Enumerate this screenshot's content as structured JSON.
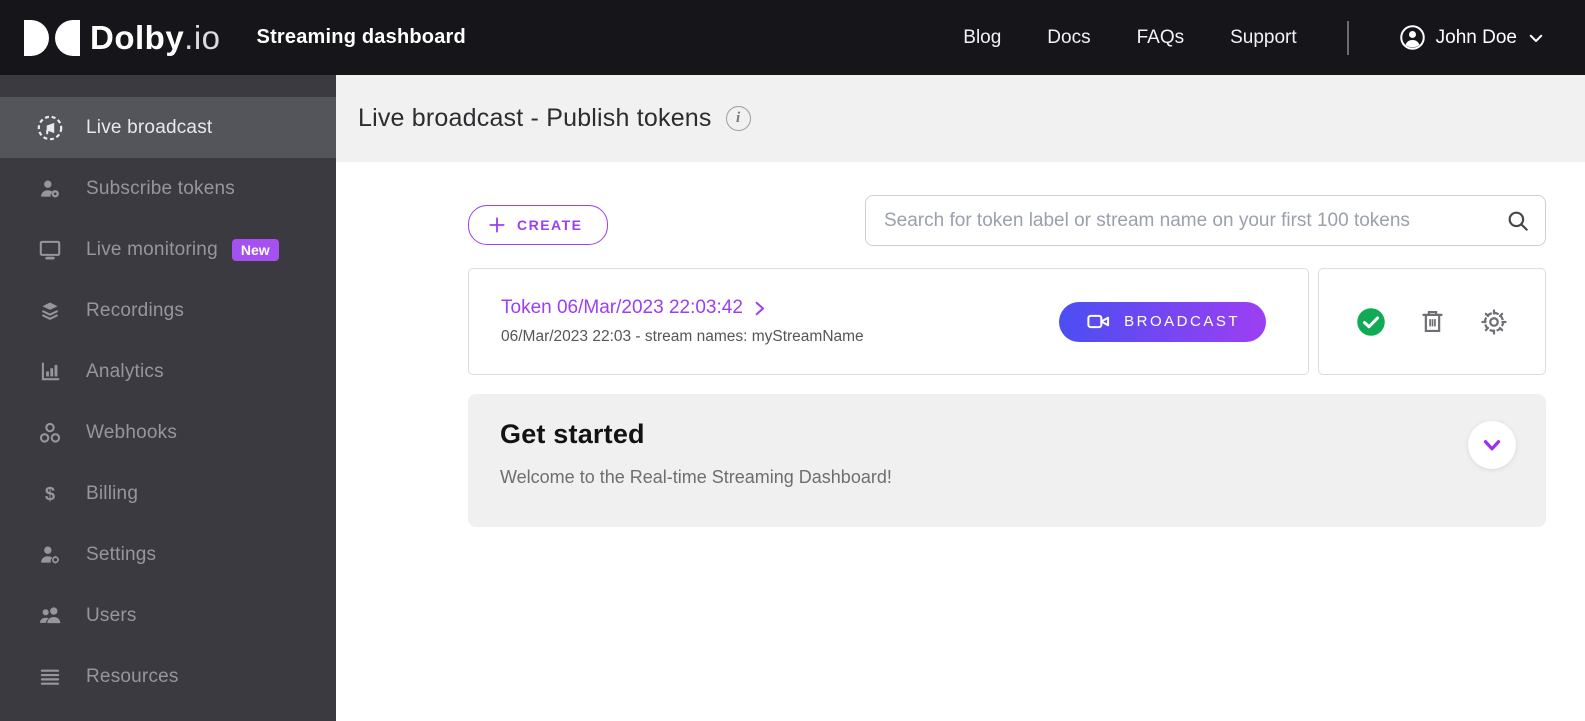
{
  "header": {
    "logo": {
      "brand": "Dolby",
      "suffix": ".io"
    },
    "app_title": "Streaming dashboard",
    "nav": [
      "Blog",
      "Docs",
      "FAQs",
      "Support"
    ],
    "user_name": "John Doe"
  },
  "sidebar": {
    "items": [
      {
        "label": "Live broadcast",
        "icon": "broadcast-icon",
        "selected": true
      },
      {
        "label": "Subscribe tokens",
        "icon": "subscriber-icon"
      },
      {
        "label": "Live monitoring",
        "icon": "monitor-icon",
        "badge": "New"
      },
      {
        "label": "Recordings",
        "icon": "layers-icon"
      },
      {
        "label": "Analytics",
        "icon": "bar-chart-icon"
      },
      {
        "label": "Webhooks",
        "icon": "webhook-icon"
      },
      {
        "label": "Billing",
        "icon": "dollar-icon"
      },
      {
        "label": "Settings",
        "icon": "user-gear-icon"
      },
      {
        "label": "Users",
        "icon": "users-icon"
      },
      {
        "label": "Resources",
        "icon": "list-icon"
      }
    ]
  },
  "main": {
    "page_title": "Live broadcast - Publish tokens",
    "toolbar": {
      "create_label": "CREATE",
      "search_placeholder": "Search for token label or stream name on your first 100 tokens"
    },
    "token": {
      "title": "Token 06/Mar/2023 22:03:42",
      "subtitle": "06/Mar/2023 22:03 - stream names: myStreamName",
      "broadcast_label": "BROADCAST"
    },
    "get_started": {
      "title": "Get started",
      "subtitle": "Welcome to the Real-time Streaming Dashboard!"
    }
  },
  "colors": {
    "accent_purple": "#9C3EF2",
    "broadcast_gradient_start": "#4B4EF2",
    "broadcast_gradient_end": "#9D3FF2",
    "success_green": "#12AB55",
    "new_badge_purple": "#A551F2",
    "header_bg": "#15151A",
    "sidebar_bg": "#3A3A40",
    "sidebar_selected_bg": "#54545B",
    "title_band_bg": "#F1F1F2"
  }
}
